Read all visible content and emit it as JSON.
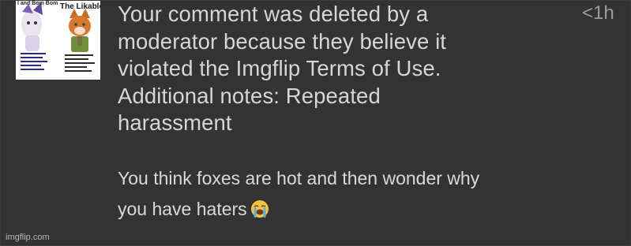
{
  "thumbnail": {
    "caption_left": "I and Bom Bom",
    "caption_right": "The Likable, J"
  },
  "notification": {
    "lines": [
      "Your comment was deleted by a",
      "moderator because they believe it",
      "violated the Imgflip Terms of Use.",
      "Additional notes: Repeated",
      "harassment"
    ],
    "timestamp": "<1h"
  },
  "comment": {
    "lines": [
      "You think foxes are hot and then wonder why",
      "you have haters"
    ],
    "emoji": "loudly-crying-face-icon"
  },
  "watermark": "imgflip.com",
  "colors": {
    "background": "#333333",
    "text": "#d6d6d6",
    "timestamp": "#9a9a9a"
  }
}
